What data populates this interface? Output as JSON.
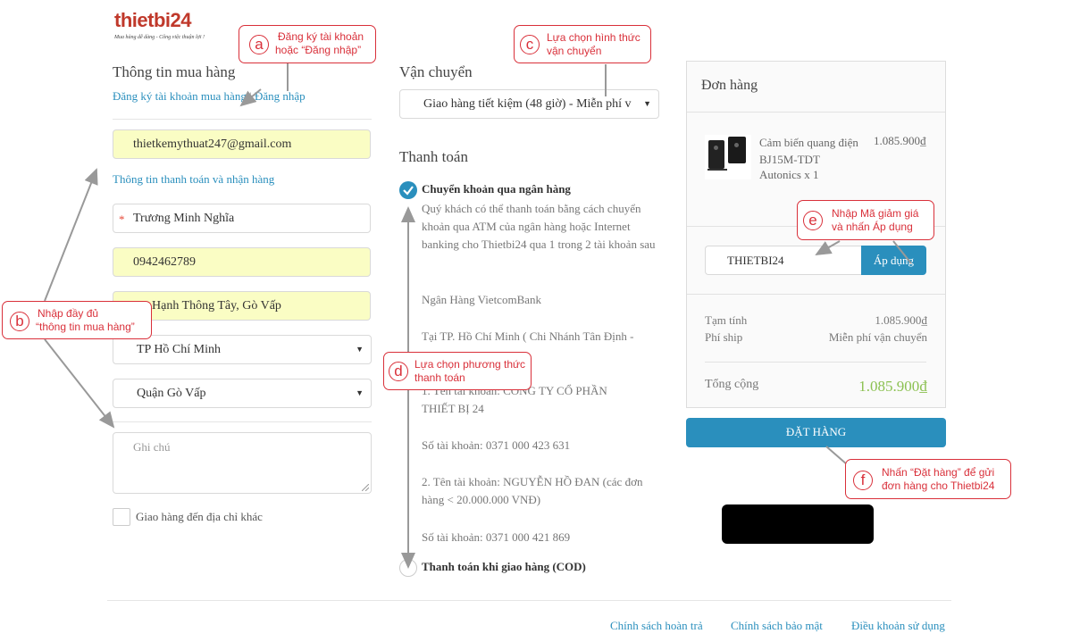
{
  "logo": {
    "text": "thietbi24",
    "slogan": "Mua hàng dễ dàng - Công việc thuận lợi !"
  },
  "purchase_info": {
    "title": "Thông tin mua hàng",
    "register_link": "Đăng ký tài khoản mua hàng",
    "separator": "|",
    "login_link": "Đăng nhập",
    "email": "thietkemythuat247@gmail.com",
    "billing_link": "Thông tin thanh toán và nhận hàng",
    "required_mark": "*",
    "name": "Trương Minh Nghĩa",
    "phone": "0942462789",
    "address": "24, Hạnh Thông Tây, Gò Vấp",
    "city": "TP Hồ Chí Minh",
    "district": "Quận Gò Vấp",
    "note_placeholder": "Ghi chú",
    "other_address_label": "Giao hàng đến địa chỉ khác"
  },
  "shipping": {
    "title": "Vận chuyển",
    "selected": "Giao hàng tiết kiệm (48 giờ) - Miễn phí v"
  },
  "payment": {
    "title": "Thanh toán",
    "option_bank": "Chuyển khoản qua ngân hàng",
    "bank_description": "Quý khách có thể thanh toán bằng cách chuyển khoản qua ATM của ngân hàng hoặc Internet banking cho Thietbi24 qua 1 trong 2 tài khoản sau",
    "bank_name": "Ngân Hàng VietcomBank",
    "branch": "Tại TP. Hồ Chí Minh ( Chi Nhánh Tân Định -",
    "account1_name": "1. Tên tài khoản: CÔNG TY CỔ PHẦN THIẾT BỊ 24",
    "account1_number": "Số tài khoản: 0371 000 423 631",
    "account2_name": "2. Tên tài khoản: NGUYỄN HỒ ĐAN (các đơn hàng < 20.000.000 VNĐ)",
    "account2_number": "Số tài khoản: 0371 000 421 869",
    "option_cod": "Thanh toán khi giao hàng (COD)"
  },
  "order": {
    "title": "Đơn hàng",
    "product_name": "Cảm biến quang điện BJ15M-TDT",
    "product_brand": "Autonics x 1",
    "product_price": "1.085.900₫",
    "coupon_value": "THIETBI24",
    "apply_button": "Áp dụng",
    "subtotal_label": "Tạm tính",
    "subtotal_value": "1.085.900₫",
    "shipping_label": "Phí ship",
    "shipping_value": "Miễn phí vận chuyển",
    "total_label": "Tổng cộng",
    "total_value": "1.085.900₫",
    "place_order_button": "ĐẶT HÀNG"
  },
  "callouts": {
    "a": {
      "letter": "a",
      "line1": "Đăng ký tài khoản",
      "line2": "hoặc “Đăng nhập”"
    },
    "b": {
      "letter": "b",
      "line1": "Nhập đầy đủ",
      "line2": "“thông tin mua hàng”"
    },
    "c": {
      "letter": "c",
      "line1": "Lựa chọn hình thức",
      "line2": "vận chuyển"
    },
    "d": {
      "letter": "d",
      "line1": "Lựa chọn phương thức",
      "line2": "thanh toán"
    },
    "e": {
      "letter": "e",
      "line1": "Nhập Mã  giảm giá",
      "line2": "và nhấn Áp dụng"
    },
    "f": {
      "letter": "f",
      "line1": "Nhấn “Đặt hàng” để gửi",
      "line2": "đơn hàng  cho Thietbi24"
    }
  },
  "footer": {
    "refund_policy": "Chính sách hoàn trả",
    "privacy_policy": "Chính sách bảo mật",
    "terms": "Điều khoản sử dụng"
  },
  "colors": {
    "accent": "#2a8fbd",
    "callout_red": "#d9303a",
    "total_green": "#8cc152",
    "field_yellow": "#fafdc4",
    "logo_red": "#c0392b"
  }
}
